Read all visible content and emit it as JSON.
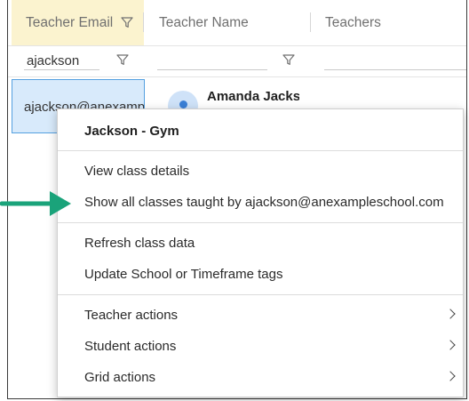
{
  "grid": {
    "headers": [
      {
        "label": "Teacher Email",
        "active": true,
        "has_filter_icon": true
      },
      {
        "label": "Teacher Name",
        "active": false,
        "has_filter_icon": false
      },
      {
        "label": "Teachers",
        "active": false,
        "has_filter_icon": false
      }
    ],
    "filters": [
      {
        "value": "ajackson"
      },
      {
        "value": ""
      },
      {
        "value": ""
      }
    ],
    "row": {
      "email": "ajackson@anexampleschool.com",
      "name": "Amanda Jackson"
    }
  },
  "context_menu": {
    "title": "Jackson - Gym",
    "items": [
      {
        "label": "View class details",
        "submenu": false
      },
      {
        "label": "Show all classes taught by ajackson@anexampleschool.com",
        "submenu": false
      },
      {
        "label": "Refresh class data",
        "submenu": false
      },
      {
        "label": "Update School or Timeframe tags",
        "submenu": false
      },
      {
        "label": "Teacher actions",
        "submenu": true
      },
      {
        "label": "Student actions",
        "submenu": true
      },
      {
        "label": "Grid actions",
        "submenu": true
      }
    ]
  },
  "annotation": {
    "arrow_icon": "arrow-right-icon",
    "arrow_color": "#1aa37a"
  },
  "colors": {
    "active_header_bg": "#fbf3cf",
    "selected_cell_bg": "#d8eafb",
    "selected_cell_border": "#55a0e0",
    "avatar_bg": "#cfe2f8",
    "avatar_dot": "#3a7fd6"
  }
}
